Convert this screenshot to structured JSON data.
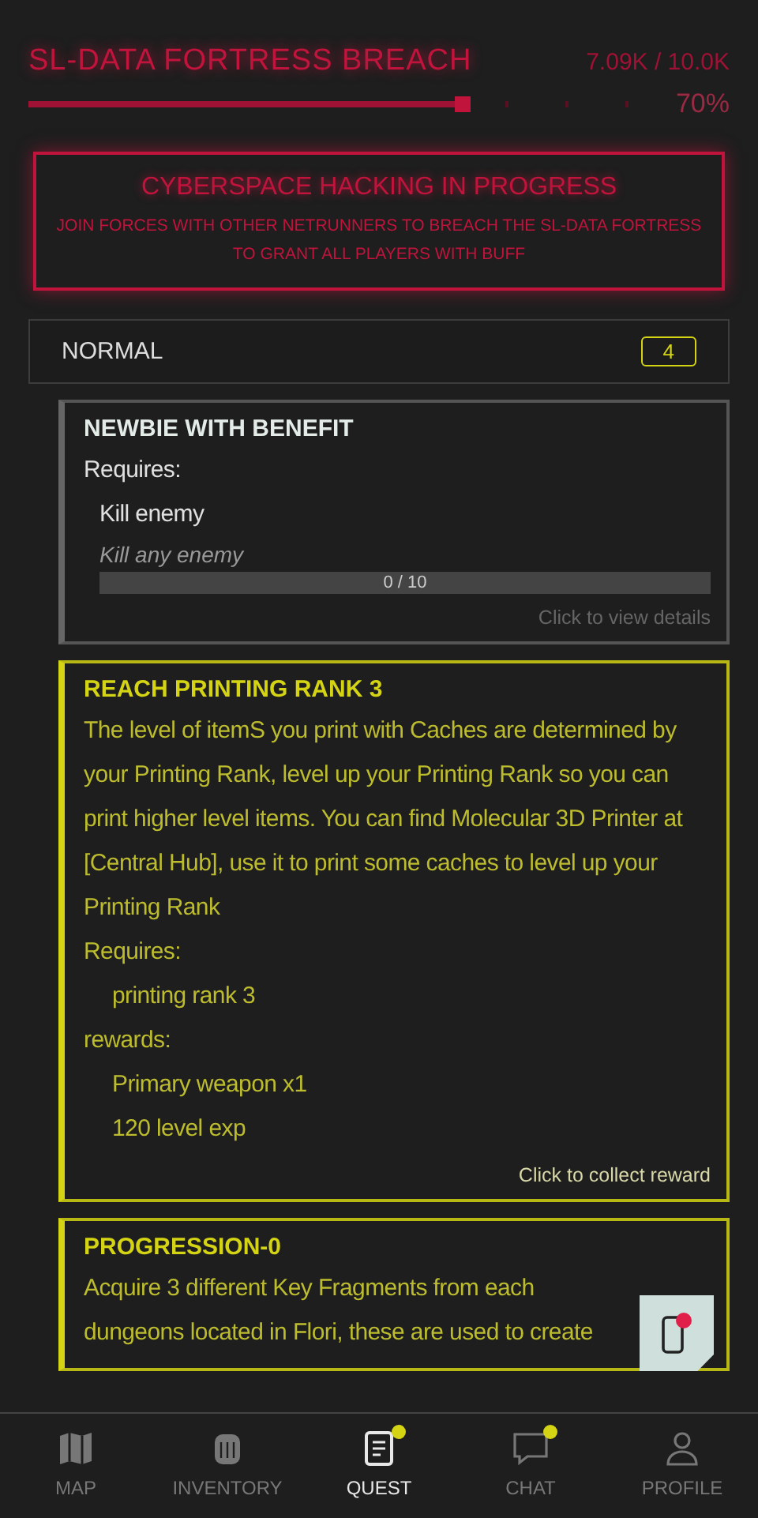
{
  "event": {
    "title": "SL-DATA FORTRESS BREACH",
    "count": "7.09K / 10.0K",
    "level": 0.7,
    "percent": "70%"
  },
  "banner": {
    "title": "CYBERSPACE HACKING IN PROGRESS",
    "text": "JOIN FORCES WITH OTHER NETRUNNERS TO BREACH THE SL-DATA FORTRESS TO GRANT ALL PLAYERS WITH BUFF"
  },
  "category": {
    "label": "NORMAL",
    "count": "4"
  },
  "quests": [
    {
      "completed": false,
      "title": "NEWBIE WITH BENEFIT",
      "requires_label": "Requires:",
      "objectives": [
        {
          "name": "Kill enemy",
          "hint": "Kill any enemy",
          "progress": "0 / 10"
        }
      ],
      "footer": "Click to view details"
    },
    {
      "completed": true,
      "title": "REACH PRINTING RANK 3",
      "description": "The level of itemS you print with Caches are determined by your Printing Rank, level up your Printing Rank so you can print higher level items. You can find Molecular 3D Printer at [Central Hub], use it to print some caches to level up your Printing Rank",
      "requires_label": "Requires:",
      "requirements": [
        "printing rank 3"
      ],
      "rewards_label": "rewards:",
      "rewards": [
        "Primary weapon x1",
        "120 level exp"
      ],
      "footer": "Click to collect reward"
    },
    {
      "completed": true,
      "title": "PROGRESSION-0",
      "description": "Acquire 3 different Key Fragments from each dungeons located in Flori, these are used to create"
    }
  ],
  "float_button": {
    "badge": true
  },
  "nav": [
    {
      "kind": "map",
      "label": "MAP",
      "selected": false,
      "badge": false
    },
    {
      "kind": "inventory",
      "label": "INVENTORY",
      "selected": false,
      "badge": false
    },
    {
      "kind": "quest",
      "label": "QUEST",
      "selected": true,
      "badge": true
    },
    {
      "kind": "chat",
      "label": "CHAT",
      "selected": false,
      "badge": true
    },
    {
      "kind": "profile",
      "label": "PROFILE",
      "selected": false,
      "badge": false
    }
  ]
}
